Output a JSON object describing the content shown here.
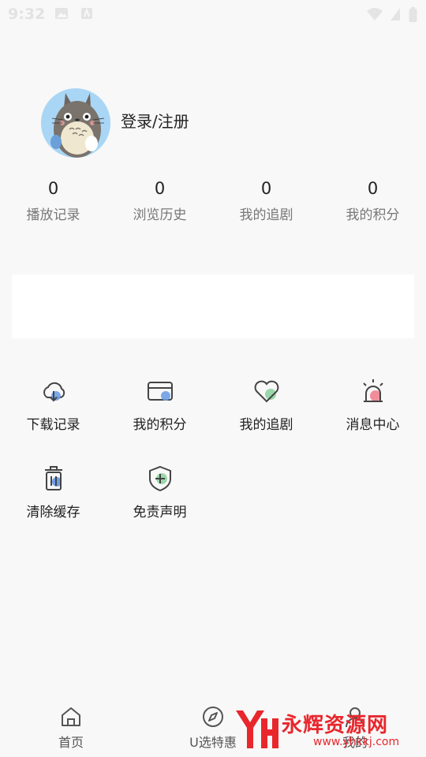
{
  "status_bar": {
    "time": "9:32"
  },
  "profile": {
    "login_label": "登录/注册"
  },
  "stats": [
    {
      "value": "0",
      "label": "播放记录"
    },
    {
      "value": "0",
      "label": "浏览历史"
    },
    {
      "value": "0",
      "label": "我的追剧"
    },
    {
      "value": "0",
      "label": "我的积分"
    }
  ],
  "menu": [
    {
      "label": "下载记录",
      "icon": "cloud-download-icon"
    },
    {
      "label": "我的积分",
      "icon": "card-icon"
    },
    {
      "label": "我的追剧",
      "icon": "heart-icon"
    },
    {
      "label": "消息中心",
      "icon": "alarm-icon"
    },
    {
      "label": "清除缓存",
      "icon": "trash-icon"
    },
    {
      "label": "免责声明",
      "icon": "shield-icon"
    }
  ],
  "tabbar": [
    {
      "label": "首页",
      "icon": "home-icon"
    },
    {
      "label": "U选特惠",
      "icon": "compass-icon"
    },
    {
      "label": "我的",
      "icon": "user-icon"
    }
  ],
  "watermark": {
    "text": "永辉资源网",
    "url": "www.yhkkj.com"
  },
  "colors": {
    "background": "#f8f8f8",
    "blue_accent": "#6f9ee6",
    "green_accent": "#9bd7a9",
    "red_accent": "#f08d99",
    "watermark": "#e8272d"
  }
}
